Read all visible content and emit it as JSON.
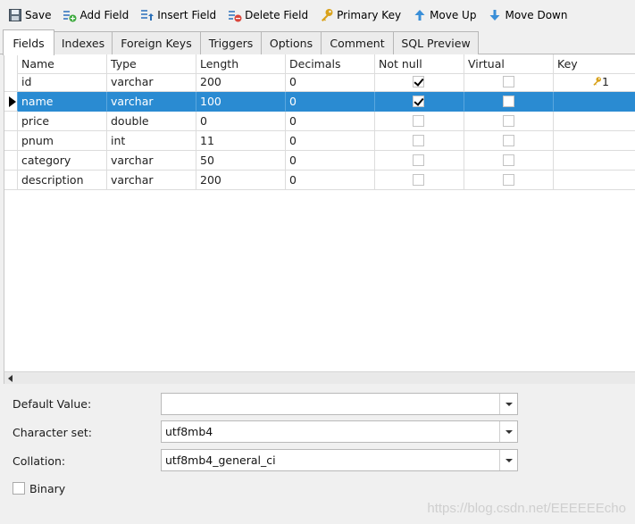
{
  "toolbar": {
    "save": "Save",
    "add_field": "Add Field",
    "insert_field": "Insert Field",
    "delete_field": "Delete Field",
    "primary_key": "Primary Key",
    "move_up": "Move Up",
    "move_down": "Move Down"
  },
  "tabs": [
    "Fields",
    "Indexes",
    "Foreign Keys",
    "Triggers",
    "Options",
    "Comment",
    "SQL Preview"
  ],
  "grid": {
    "headers": [
      "Name",
      "Type",
      "Length",
      "Decimals",
      "Not null",
      "Virtual",
      "Key"
    ],
    "rows": [
      {
        "name": "id",
        "type": "varchar",
        "length": "200",
        "decimals": "0",
        "not_null": true,
        "virtual": false,
        "key": "1"
      },
      {
        "name": "name",
        "type": "varchar",
        "length": "100",
        "decimals": "0",
        "not_null": true,
        "virtual": false,
        "key": ""
      },
      {
        "name": "price",
        "type": "double",
        "length": "0",
        "decimals": "0",
        "not_null": false,
        "virtual": false,
        "key": ""
      },
      {
        "name": "pnum",
        "type": "int",
        "length": "11",
        "decimals": "0",
        "not_null": false,
        "virtual": false,
        "key": ""
      },
      {
        "name": "category",
        "type": "varchar",
        "length": "50",
        "decimals": "0",
        "not_null": false,
        "virtual": false,
        "key": ""
      },
      {
        "name": "description",
        "type": "varchar",
        "length": "200",
        "decimals": "0",
        "not_null": false,
        "virtual": false,
        "key": ""
      }
    ],
    "selected_row": 1
  },
  "props": {
    "default_value_label": "Default Value:",
    "default_value": "",
    "charset_label": "Character set:",
    "charset": "utf8mb4",
    "collation_label": "Collation:",
    "collation": "utf8mb4_general_ci",
    "binary_label": "Binary",
    "binary": false
  },
  "watermark": "https://blog.csdn.net/EEEEEEcho",
  "colors": {
    "selection": "#2a8bd2",
    "key_icon": "#d9a21b"
  }
}
